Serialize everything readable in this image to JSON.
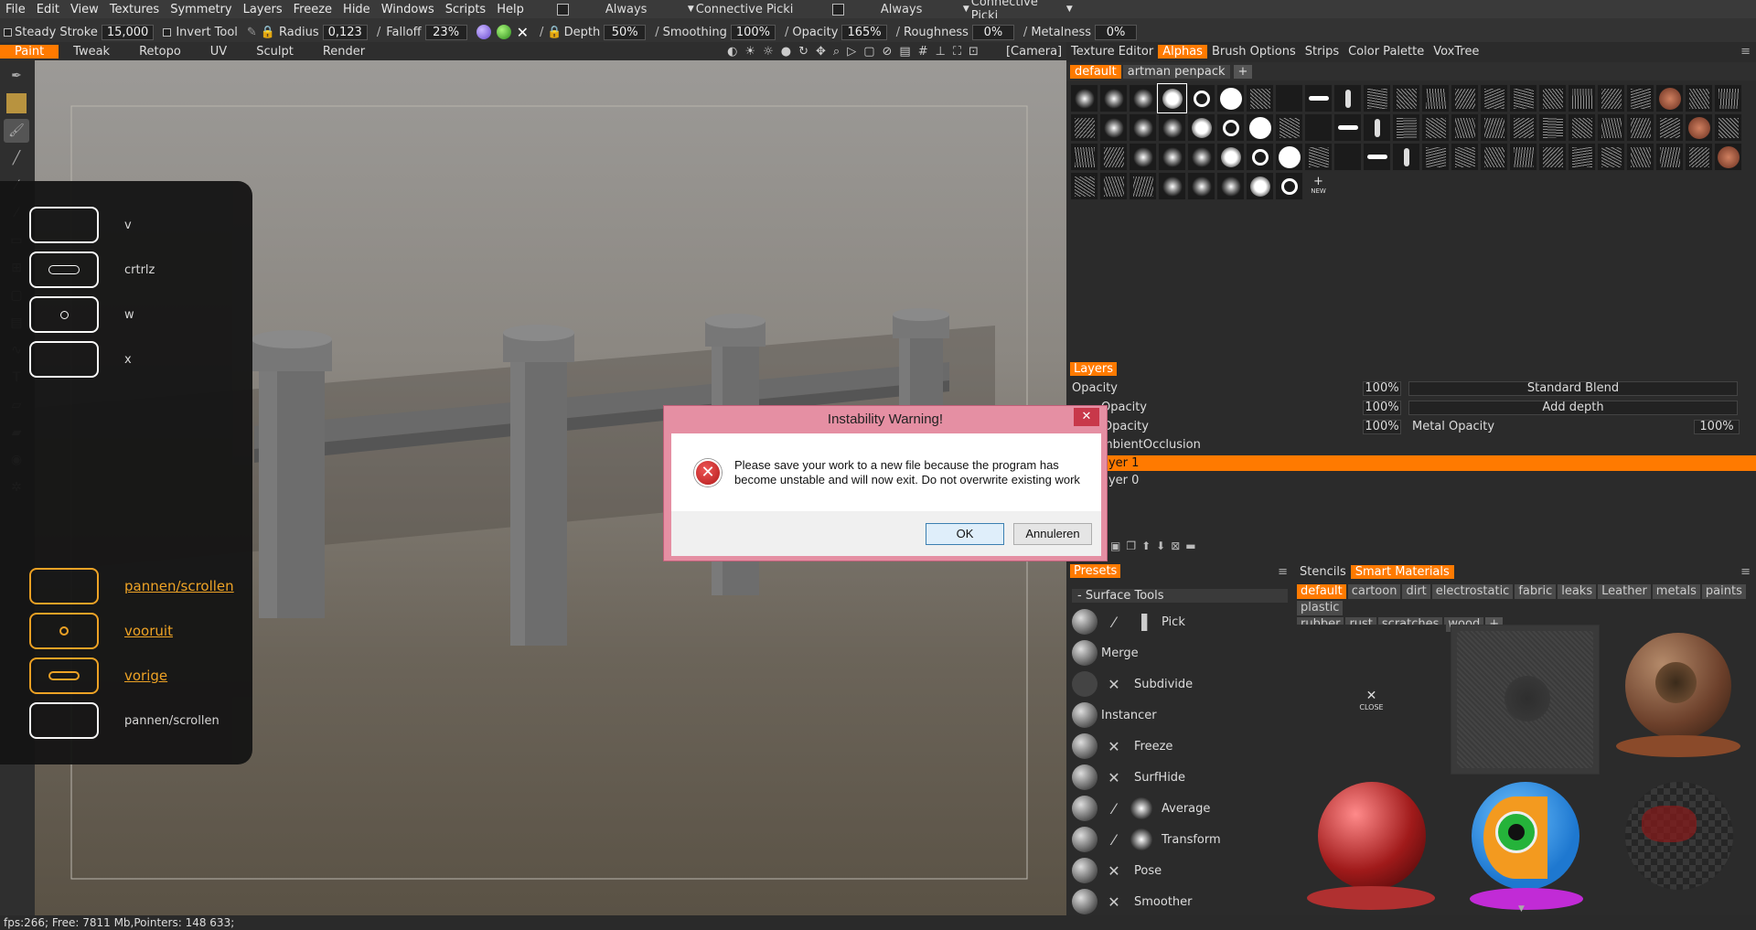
{
  "menu": [
    "File",
    "Edit",
    "View",
    "Textures",
    "Symmetry",
    "Layers",
    "Freeze",
    "Hide",
    "Windows",
    "Scripts",
    "Help"
  ],
  "menu_extra": {
    "always1": "Always",
    "connective1": "Connective Picki",
    "always2": "Always",
    "connective2": "Connective Picki"
  },
  "toolbar": {
    "steady_label": "Steady Stroke",
    "steady_value": "15,000",
    "invert_label": "Invert Tool",
    "radius_label": "Radius",
    "radius_value": "0,123",
    "falloff_label": "Falloff",
    "falloff_value": "23%",
    "depth_label": "Depth",
    "depth_value": "50%",
    "smoothing_label": "Smoothing",
    "smoothing_value": "100%",
    "opacity_label": "Opacity",
    "opacity_value": "165%",
    "roughness_label": "Roughness",
    "roughness_value": "0%",
    "metalness_label": "Metalness",
    "metalness_value": "0%"
  },
  "modes": [
    "Paint",
    "Tweak",
    "Retopo",
    "UV",
    "Sculpt",
    "Render"
  ],
  "camera_label": "[Camera]",
  "stylus": {
    "items": [
      {
        "label": "v"
      },
      {
        "label": "crtrlz"
      },
      {
        "label": "w"
      },
      {
        "label": "x"
      },
      {
        "label": "pannen/scrollen"
      },
      {
        "label": "vooruit"
      },
      {
        "label": "vorige"
      },
      {
        "label": "pannen/scrollen"
      }
    ]
  },
  "right_tabs": [
    "Texture Editor",
    "Alphas",
    "Brush Options",
    "Strips",
    "Color Palette",
    "VoxTree"
  ],
  "alpha_sets": [
    "default",
    "artman penpack"
  ],
  "alpha_new_label": "NEW",
  "layers": {
    "title": "Layers",
    "opacity_label": "Opacity",
    "opacity_val": "100%",
    "blend": "Standard Blend",
    "depth_opacity_label": "Opacity",
    "depth_opacity_val": "100%",
    "depth_blend": "Add depth",
    "rough_opacity_label": "ness Opacity",
    "rough_opacity_val": "100%",
    "metal_opacity_label": "Metal Opacity",
    "metal_opacity_val": "100%",
    "items": [
      "mbientOcclusion",
      "ayer 1",
      "ayer 0"
    ]
  },
  "presets": {
    "title": "Presets",
    "group": "Surface Tools",
    "items": [
      "Pick",
      "Merge",
      "Subdivide",
      "Instancer",
      "Freeze",
      "SurfHide",
      "Average",
      "Transform",
      "Pose",
      "Smoother"
    ]
  },
  "smart": {
    "tabs": [
      "Stencils",
      "Smart Materials"
    ],
    "tags": [
      "default",
      "cartoon",
      "dirt",
      "electrostatic",
      "fabric",
      "leaks",
      "Leather",
      "metals",
      "paints",
      "plastic",
      "rubber",
      "rust",
      "scratches",
      "wood"
    ],
    "close_label": "CLOSE"
  },
  "dialog": {
    "title": "Instability Warning!",
    "message": "Please save your work to a new file because the program has become unstable and will now exit. Do not overwrite existing work",
    "ok": "OK",
    "cancel": "Annuleren",
    "close_glyph": "✕"
  },
  "status": "fps:266;    Free: 7811 Mb,Pointers: 148 633;"
}
